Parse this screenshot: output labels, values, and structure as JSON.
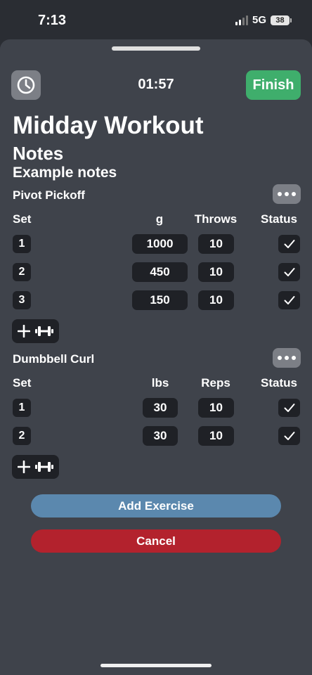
{
  "status_bar": {
    "time": "7:13",
    "network": "5G",
    "battery": "38",
    "signal_bars": 4,
    "signal_bars_filled": 2
  },
  "header": {
    "timer": "01:57",
    "finish_label": "Finish",
    "timer_icon": "clock-icon"
  },
  "workout": {
    "title": "Midday Workout",
    "notes_heading": "Notes",
    "notes_text": "Example notes"
  },
  "exercises": [
    {
      "name": "Pivot Pickoff",
      "columns": {
        "set": "Set",
        "weight": "g",
        "reps": "Throws",
        "status": "Status"
      },
      "sets": [
        {
          "set": "1",
          "weight": "1000",
          "reps": "10",
          "done": true
        },
        {
          "set": "2",
          "weight": "450",
          "reps": "10",
          "done": true
        },
        {
          "set": "3",
          "weight": "150",
          "reps": "10",
          "done": true
        }
      ]
    },
    {
      "name": "Dumbbell Curl",
      "columns": {
        "set": "Set",
        "weight": "lbs",
        "reps": "Reps",
        "status": "Status"
      },
      "sets": [
        {
          "set": "1",
          "weight": "30",
          "reps": "10",
          "done": true
        },
        {
          "set": "2",
          "weight": "30",
          "reps": "10",
          "done": true
        }
      ]
    }
  ],
  "actions": {
    "add_exercise": "Add Exercise",
    "cancel": "Cancel"
  },
  "colors": {
    "background": "#2a2d33",
    "sheet": "#3f434b",
    "finish": "#3fae6c",
    "add_exercise": "#5b88ae",
    "cancel": "#b3222d",
    "field": "#1f2126"
  }
}
